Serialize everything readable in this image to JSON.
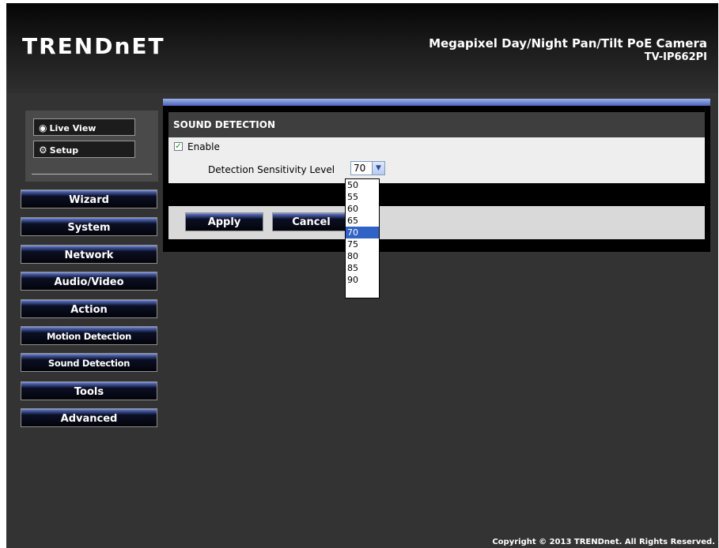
{
  "header": {
    "logo": "TRENDnET",
    "product_title": "Megapixel Day/Night Pan/Tilt PoE Camera",
    "model": "TV-IP662PI"
  },
  "view_buttons": {
    "live_view": "Live View",
    "setup": "Setup"
  },
  "nav": {
    "items": [
      {
        "label": "Wizard"
      },
      {
        "label": "System"
      },
      {
        "label": "Network"
      },
      {
        "label": "Audio/Video"
      },
      {
        "label": "Action"
      },
      {
        "label": "Motion Detection"
      },
      {
        "label": "Sound Detection"
      },
      {
        "label": "Tools"
      },
      {
        "label": "Advanced"
      }
    ]
  },
  "panel": {
    "title": "SOUND DETECTION",
    "enable_label": "Enable",
    "enable_checked": true,
    "sensitivity_label": "Detection Sensitivity Level",
    "sensitivity_value": "70",
    "sensitivity_options": [
      "50",
      "55",
      "60",
      "65",
      "70",
      "75",
      "80",
      "85",
      "90"
    ]
  },
  "actions": {
    "apply": "Apply",
    "cancel": "Cancel"
  },
  "footer": {
    "copyright": "Copyright © 2013 TRENDnet. All Rights Reserved."
  },
  "colors": {
    "accent_blue": "#4b62b8",
    "selected_option": "#3162c5"
  }
}
